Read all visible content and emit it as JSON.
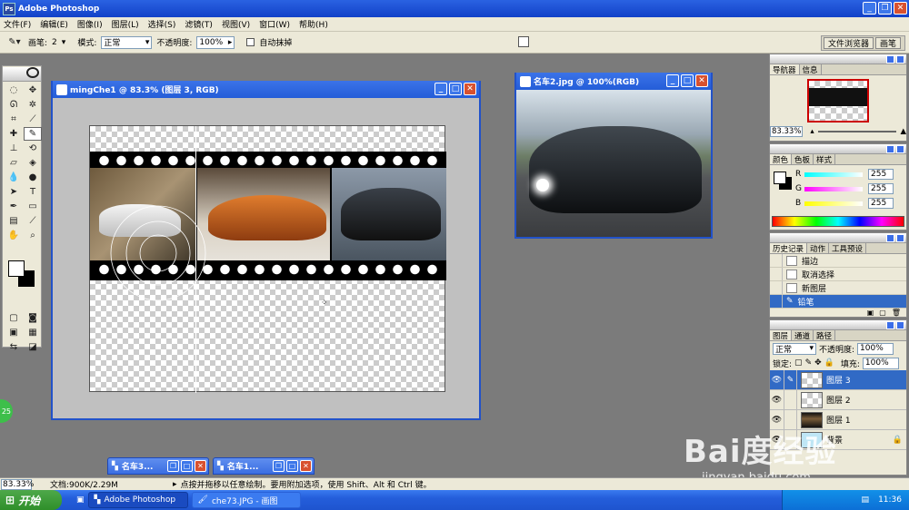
{
  "app": {
    "title": "Adobe Photoshop"
  },
  "menu": [
    "文件(F)",
    "编辑(E)",
    "图像(I)",
    "图层(L)",
    "选择(S)",
    "滤镜(T)",
    "视图(V)",
    "窗口(W)",
    "帮助(H)"
  ],
  "options": {
    "brush_label": "画笔:",
    "brush_size": "2",
    "mode_label": "模式:",
    "mode_value": "正常",
    "opacity_label": "不透明度:",
    "opacity_value": "100%",
    "auto_erase": "自动抹掉",
    "tab_browser": "文件浏览器",
    "tab_brushes": "画笔"
  },
  "doc_main": {
    "title": "mingChe1 @ 83.3% (图层 3, RGB)"
  },
  "doc_second": {
    "title": "名车2.jpg @ 100%(RGB)"
  },
  "minimized": [
    {
      "title": "名车3..."
    },
    {
      "title": "名车1..."
    }
  ],
  "navigator": {
    "tabs": [
      "导航器",
      "信息"
    ],
    "zoom": "83.33%"
  },
  "color_panel": {
    "tabs": [
      "颜色",
      "色板",
      "样式"
    ],
    "r_label": "R",
    "r_value": "255",
    "g_label": "G",
    "g_value": "255",
    "b_label": "B",
    "b_value": "255"
  },
  "history": {
    "tabs": [
      "历史记录",
      "动作",
      "工具预设"
    ],
    "items": [
      "描边",
      "取消选择",
      "新图层",
      "铅笔"
    ]
  },
  "layers": {
    "tabs": [
      "图层",
      "通道",
      "路径"
    ],
    "mode": "正常",
    "opacity_label": "不透明度:",
    "opacity_value": "100%",
    "lock_label": "锁定:",
    "fill_label": "填充:",
    "fill_value": "100%",
    "items": [
      "图层 3",
      "图层 2",
      "图层 1",
      "背景"
    ]
  },
  "status": {
    "zoom": "83.33%",
    "doc_size": "文档:900K/2.29M",
    "hint": "点按并拖移以任意绘制。要用附加选项，使用 Shift、Alt 和 Ctrl 键。"
  },
  "taskbar": {
    "start": "开始",
    "tasks": [
      "Adobe Photoshop",
      "che73.JPG - 画图"
    ],
    "clock": "11:36"
  },
  "watermark": {
    "brand": "Bai度经验",
    "url": "jingyan.baidu.com"
  },
  "colors": {
    "xp_blue": "#245dd8",
    "panel_bg": "#ece9d8",
    "selection": "#316ac5",
    "desktop_gray": "#7b7b7b"
  }
}
